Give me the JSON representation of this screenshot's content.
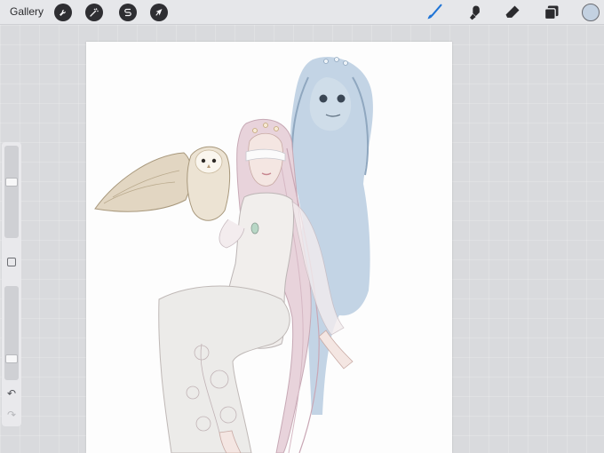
{
  "toolbar": {
    "gallery_label": "Gallery",
    "left_tools": [
      {
        "name": "actions",
        "icon": "wrench-icon"
      },
      {
        "name": "adjustments",
        "icon": "magic-wand-icon"
      },
      {
        "name": "selection",
        "icon": "selection-s-icon"
      },
      {
        "name": "transform",
        "icon": "cursor-arrow-icon"
      }
    ],
    "right_tools": [
      {
        "name": "brush",
        "icon": "brush-icon",
        "active": true
      },
      {
        "name": "smudge",
        "icon": "smudge-icon",
        "active": false
      },
      {
        "name": "eraser",
        "icon": "eraser-icon",
        "active": false
      },
      {
        "name": "layers",
        "icon": "layers-icon",
        "active": false
      }
    ],
    "current_color": "#c3d1e1",
    "accent_color": "#1f74d6"
  },
  "sidebar": {
    "brush_size_level": 0.62,
    "opacity_level": 0.2,
    "undo_icon": "undo-icon",
    "redo_icon": "redo-icon"
  },
  "canvas": {
    "background": "#fdfdfd",
    "artwork": "digital-illustration"
  }
}
